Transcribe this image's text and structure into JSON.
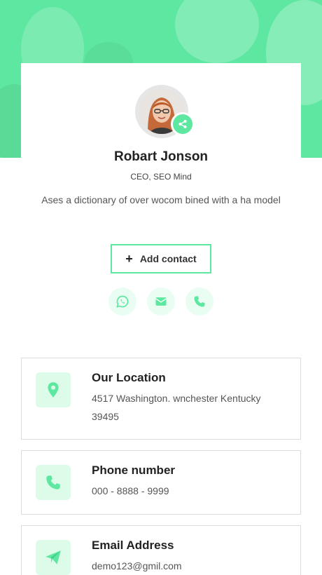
{
  "profile": {
    "name": "Robart Jonson",
    "role": "CEO, SEO Mind",
    "bio": "Ases a dictionary of over wocom bined with a ha model",
    "add_contact_label": "Add contact"
  },
  "social": [
    {
      "icon": "whatsapp-icon"
    },
    {
      "icon": "envelope-icon"
    },
    {
      "icon": "phone-icon"
    }
  ],
  "info": {
    "location": {
      "title": "Our Location",
      "text": "4517 Washington. wnchester Kentucky 39495",
      "icon": "map-pin-icon"
    },
    "phone": {
      "title": "Phone number",
      "text": "000 - 8888 - 9999",
      "icon": "phone-icon"
    },
    "email": {
      "title": "Email Address",
      "text": "demo123@gmil.com",
      "icon": "paper-plane-icon"
    }
  },
  "colors": {
    "accent": "#5ee7a0",
    "accent_light": "#dcfbe9",
    "text_dark": "#222222"
  }
}
